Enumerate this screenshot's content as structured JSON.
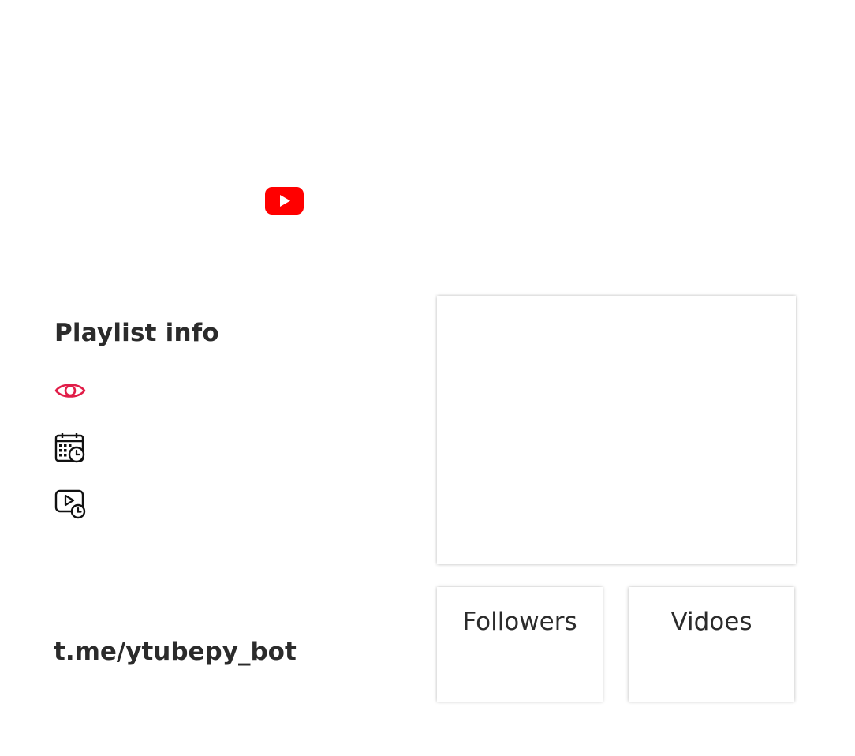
{
  "header": {
    "logo_icon": "youtube-play-icon",
    "brand_color": "#ff0000"
  },
  "info": {
    "title": "Playlist info",
    "icons": [
      "eye-icon",
      "calendar-clock-icon",
      "video-clock-icon"
    ],
    "accent_color": "#e11d48"
  },
  "footer": {
    "link": "t.me/ytubepy_bot"
  },
  "stats": {
    "followers_label": "Followers",
    "videos_label": "Vidoes"
  }
}
